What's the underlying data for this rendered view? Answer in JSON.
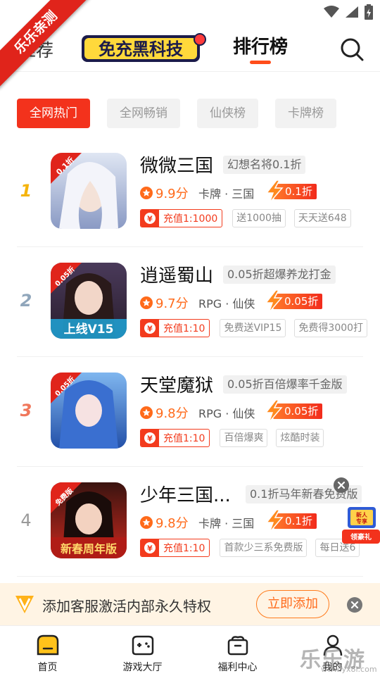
{
  "ribbon": "乐乐亲测",
  "header": {
    "tab_recommend": "推荐",
    "logo_text": "免充黑科技",
    "tab_ranking": "排行榜"
  },
  "filters": [
    "全网热门",
    "全网畅销",
    "仙侠榜",
    "卡牌榜"
  ],
  "games": [
    {
      "rank": "1",
      "name": "微微三国",
      "tagline": "幻想名将0.1折",
      "score": "9.9分",
      "category": "卡牌 · 三国",
      "discount": "0.1折",
      "recharge": "充值1:1000",
      "tags": [
        "送1000抽",
        "天天送648"
      ],
      "icon_badge": "0.1折",
      "icon_caption": ""
    },
    {
      "rank": "2",
      "name": "逍遥蜀山",
      "tagline": "0.05折超爆养龙打金",
      "score": "9.7分",
      "category": "RPG · 仙侠",
      "discount": "0.05折",
      "recharge": "充值1:10",
      "tags": [
        "免费送VIP15",
        "免费得3000打"
      ],
      "icon_badge": "0.05折",
      "icon_caption": "上线V15"
    },
    {
      "rank": "3",
      "name": "天堂魔狱",
      "tagline": "0.05折百倍爆率千金版",
      "score": "9.8分",
      "category": "RPG · 仙侠",
      "discount": "0.05折",
      "recharge": "充值1:10",
      "tags": [
        "百倍爆爽",
        "炫酷时装"
      ],
      "icon_badge": "0.05折",
      "icon_caption": ""
    },
    {
      "rank": "4",
      "name": "少年三国...",
      "tagline": "0.1折马年新春免费版",
      "score": "9.8分",
      "category": "卡牌 · 三国",
      "discount": "0.1折",
      "recharge": "充值1:10",
      "tags": [
        "首款少三系免费版",
        "每日送6"
      ],
      "icon_badge": "免费版",
      "icon_caption": "新春周年版"
    }
  ],
  "gift": {
    "line1": "新人",
    "line2": "专享",
    "line3": "领豪礼"
  },
  "promo": {
    "text": "添加客服激活内部永久特权",
    "button": "立即添加"
  },
  "nav": [
    {
      "label": "首页"
    },
    {
      "label": "游戏大厅"
    },
    {
      "label": "福利中心"
    },
    {
      "label": "我的"
    }
  ],
  "watermark": {
    "title": "乐乐游戏",
    "url": "www.yx8l.com"
  },
  "colors": {
    "accent": "#f3321c",
    "orange": "#ff6a1a",
    "promo_bg": "#fff4e4"
  }
}
